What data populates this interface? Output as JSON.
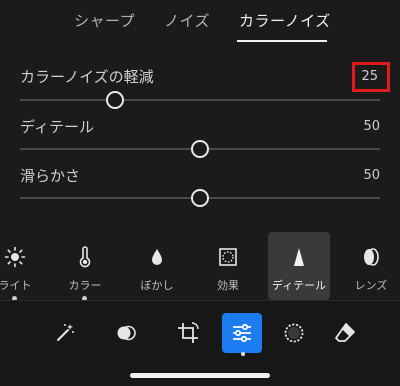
{
  "tabs": [
    {
      "label": "シャープ"
    },
    {
      "label": "ノイズ"
    },
    {
      "label": "カラーノイズ"
    }
  ],
  "sliders": [
    {
      "label": "カラーノイズの軽減",
      "value": "25",
      "percent": 25
    },
    {
      "label": "ディテール",
      "value": "50",
      "percent": 50
    },
    {
      "label": "滑らかさ",
      "value": "50",
      "percent": 50
    }
  ],
  "tools": [
    {
      "label": "ライト",
      "icon": "sun-icon"
    },
    {
      "label": "カラー",
      "icon": "thermometer-icon"
    },
    {
      "label": "ぼかし",
      "icon": "drop-icon"
    },
    {
      "label": "効果",
      "icon": "vignette-icon"
    },
    {
      "label": "ディテール",
      "icon": "detail-triangle-icon"
    },
    {
      "label": "レンズ",
      "icon": "lens-icon"
    }
  ],
  "bottom_tools": [
    {
      "icon": "magic-wand-icon"
    },
    {
      "icon": "mask-circles-icon"
    },
    {
      "icon": "crop-icon"
    },
    {
      "icon": "edit-sliders-icon"
    },
    {
      "icon": "selective-circle-icon"
    },
    {
      "icon": "eraser-icon"
    }
  ],
  "colors": {
    "highlight_box": "#e11b1b",
    "accent": "#1d7cf2"
  }
}
